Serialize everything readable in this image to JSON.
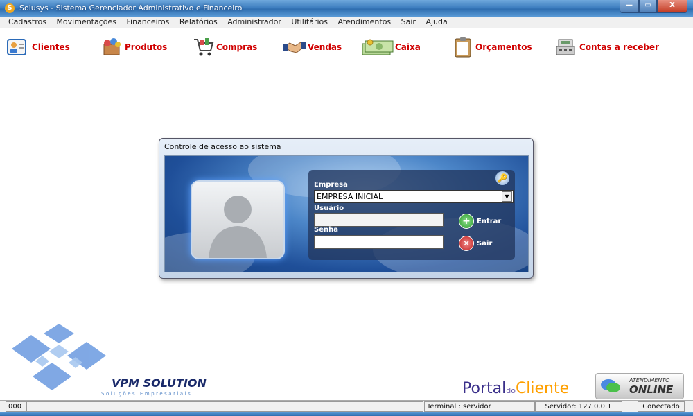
{
  "window": {
    "title": "Solusys - Sistema Gerenciador Administrativo e Financeiro",
    "app_icon_letter": "S"
  },
  "window_buttons": {
    "minimize": "—",
    "maximize": "▭",
    "close": "X"
  },
  "menu": [
    "Cadastros",
    "Movimentações",
    "Financeiros",
    "Relatórios",
    "Administrador",
    "Utilitários",
    "Atendimentos",
    "Sair",
    "Ajuda"
  ],
  "toolbar": [
    {
      "label": "Clientes",
      "icon": "clients-icon"
    },
    {
      "label": "Produtos",
      "icon": "products-icon"
    },
    {
      "label": "Compras",
      "icon": "shopping-cart-icon"
    },
    {
      "label": "Vendas",
      "icon": "handshake-icon"
    },
    {
      "label": "Caixa",
      "icon": "cash-icon"
    },
    {
      "label": "Orçamentos",
      "icon": "clipboard-icon"
    },
    {
      "label": "Contas a receber",
      "icon": "cash-register-icon"
    }
  ],
  "login": {
    "title": "Controle de acesso ao sistema",
    "empresa_label": "Empresa",
    "empresa_value": "EMPRESA INICIAL",
    "usuario_label": "Usuário",
    "usuario_value": "",
    "senha_label": "Senha",
    "senha_value": "",
    "enter_label": "Entrar",
    "exit_label": "Sair"
  },
  "branding": {
    "vpm_title": "VPM SOLUTION",
    "vpm_subtitle": "Soluções Empresariais",
    "portal_part1": "Portal",
    "portal_part2": "do",
    "portal_part3": "Cliente",
    "atendimento_top": "ATENDIMENTO",
    "atendimento_bottom": "ONLINE"
  },
  "status": {
    "code": "000",
    "terminal": "Terminal : servidor",
    "server": "Servidor: 127.0.0.1",
    "connection": "Conectado"
  },
  "colors": {
    "accent_red": "#d00000",
    "titlebar_blue": "#3f7fc0"
  }
}
